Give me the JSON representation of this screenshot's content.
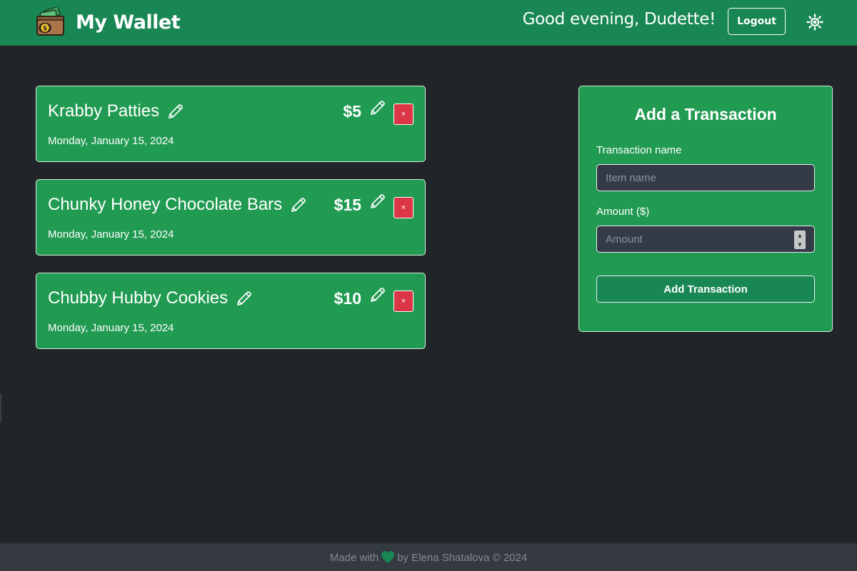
{
  "header": {
    "app_title": "My Wallet",
    "logo_icon": "wallet-logo-icon",
    "greeting": "Good evening, Dudette!",
    "logout_label": "Logout",
    "theme_icon": "sun-icon"
  },
  "transactions": [
    {
      "name": "Krabby Patties",
      "amount": "$5",
      "date": "Monday, January 15, 2024",
      "delete_label": "×"
    },
    {
      "name": "Chunky Honey Chocolate Bars",
      "amount": "$15",
      "date": "Monday, January 15, 2024",
      "delete_label": "×"
    },
    {
      "name": "Chubby Hubby Cookies",
      "amount": "$10",
      "date": "Monday, January 15, 2024",
      "delete_label": "×"
    }
  ],
  "form": {
    "title": "Add a Transaction",
    "name_label": "Transaction name",
    "name_placeholder": "Item name",
    "name_value": "",
    "amount_label": "Amount ($)",
    "amount_placeholder": "Amount",
    "amount_value": "",
    "submit_label": "Add Transaction"
  },
  "footer": {
    "made_with": "Made with",
    "byline": "by Elena Shatalova © 2024",
    "heart_icon": "heart-icon"
  },
  "colors": {
    "navbar": "#198754",
    "card": "#219a52",
    "background": "#212529",
    "danger": "#dc3545",
    "footer": "#343a40"
  }
}
